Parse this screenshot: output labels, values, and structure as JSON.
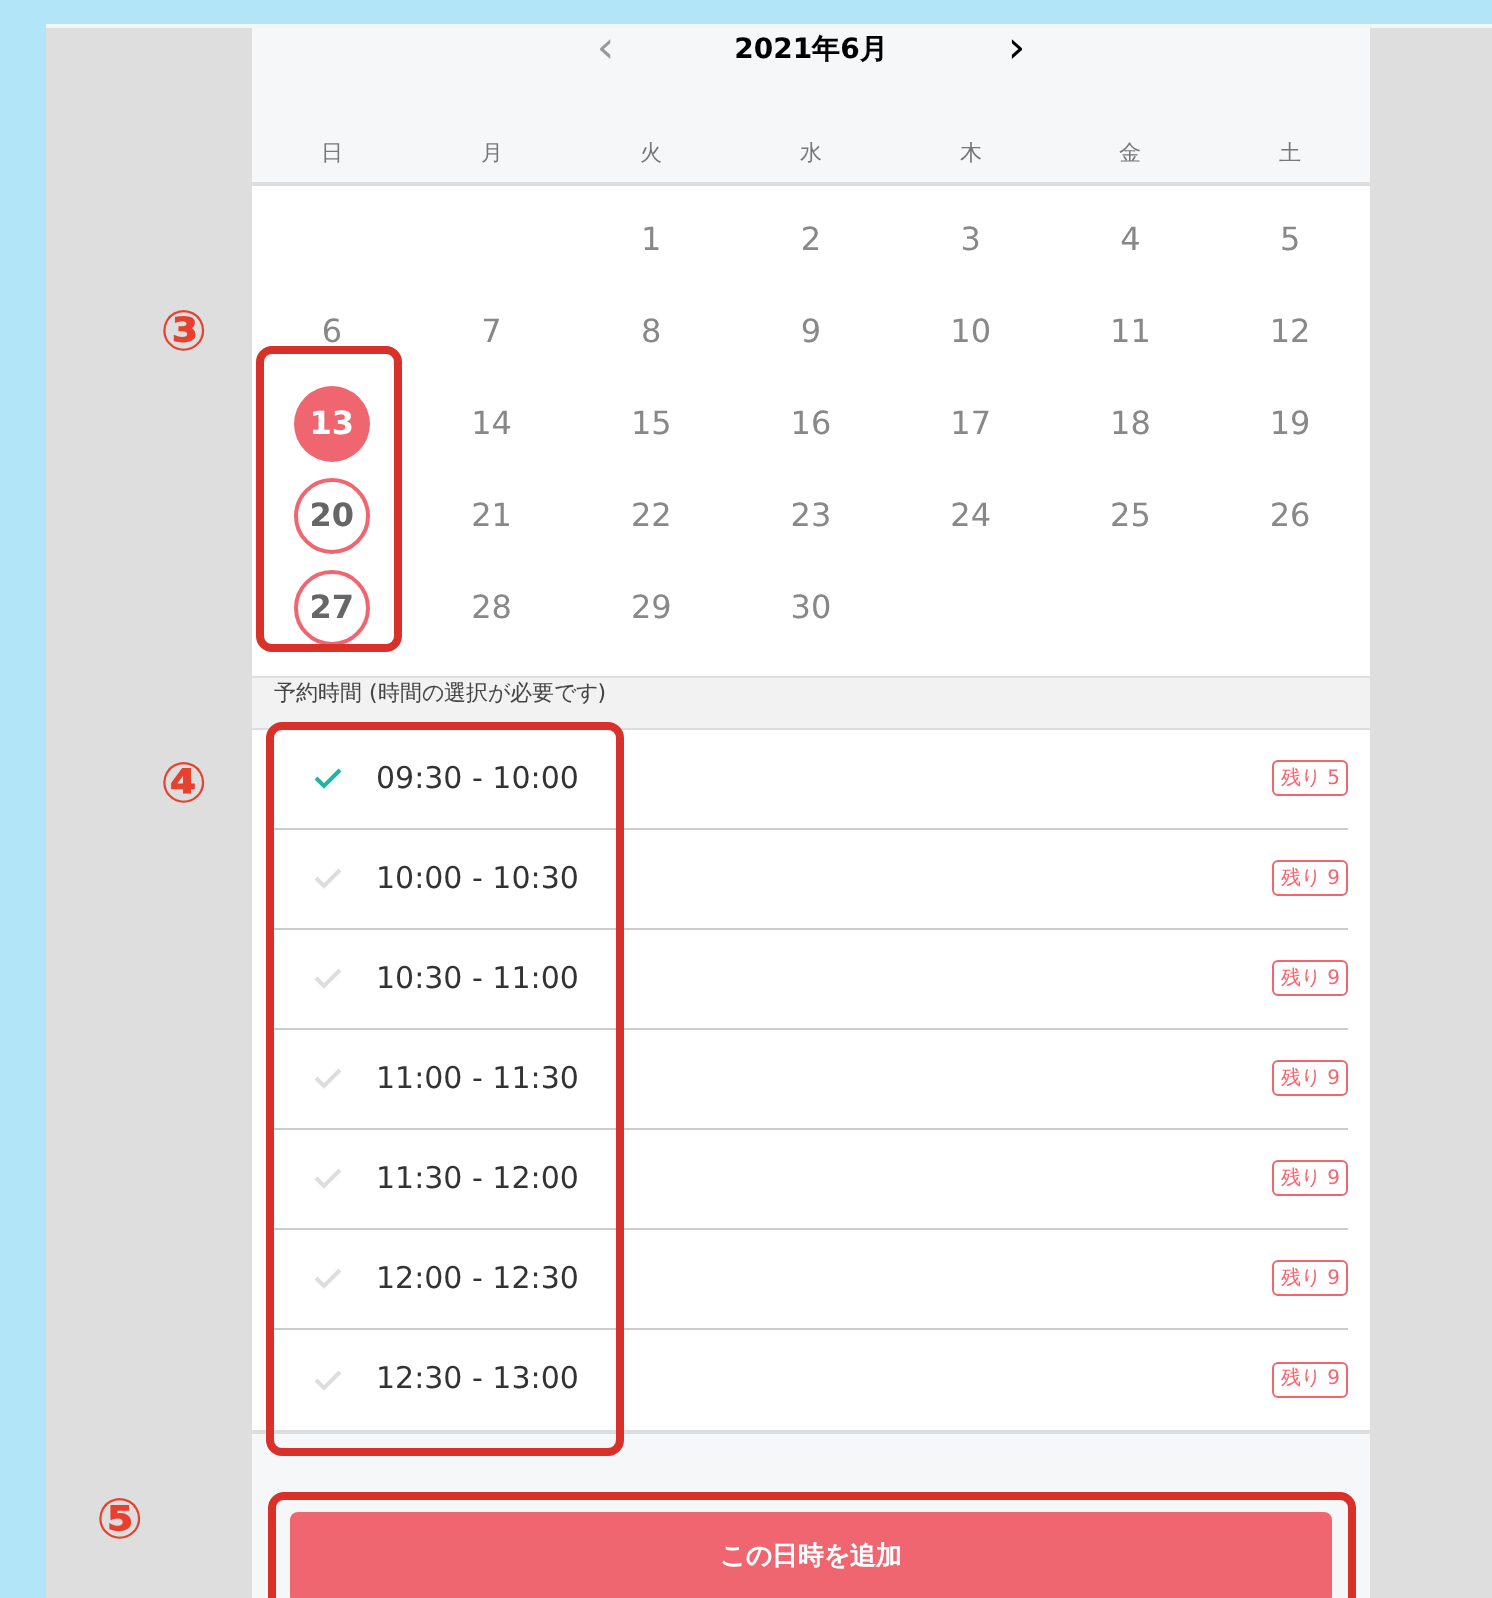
{
  "calendar": {
    "prev": "‹",
    "title": "2021年6月",
    "next": "›",
    "weekdays": [
      "日",
      "月",
      "火",
      "水",
      "木",
      "金",
      "土"
    ],
    "weeks": [
      [
        {
          "kind": "blank"
        },
        {
          "kind": "blank"
        },
        {
          "kind": "day",
          "label": "1",
          "selected": false,
          "available": false
        },
        {
          "kind": "day",
          "label": "2",
          "selected": false,
          "available": false
        },
        {
          "kind": "day",
          "label": "3",
          "selected": false,
          "available": false
        },
        {
          "kind": "day",
          "label": "4",
          "selected": false,
          "available": false
        },
        {
          "kind": "day",
          "label": "5",
          "selected": false,
          "available": false
        }
      ],
      [
        {
          "kind": "day",
          "label": "6",
          "selected": false,
          "available": false
        },
        {
          "kind": "day",
          "label": "7",
          "selected": false,
          "available": false
        },
        {
          "kind": "day",
          "label": "8",
          "selected": false,
          "available": false
        },
        {
          "kind": "day",
          "label": "9",
          "selected": false,
          "available": false
        },
        {
          "kind": "day",
          "label": "10",
          "selected": false,
          "available": false
        },
        {
          "kind": "day",
          "label": "11",
          "selected": false,
          "available": false
        },
        {
          "kind": "day",
          "label": "12",
          "selected": false,
          "available": false
        }
      ],
      [
        {
          "kind": "day",
          "label": "13",
          "selected": true,
          "available": true
        },
        {
          "kind": "day",
          "label": "14",
          "selected": false,
          "available": false
        },
        {
          "kind": "day",
          "label": "15",
          "selected": false,
          "available": false
        },
        {
          "kind": "day",
          "label": "16",
          "selected": false,
          "available": false
        },
        {
          "kind": "day",
          "label": "17",
          "selected": false,
          "available": false
        },
        {
          "kind": "day",
          "label": "18",
          "selected": false,
          "available": false
        },
        {
          "kind": "day",
          "label": "19",
          "selected": false,
          "available": false
        }
      ],
      [
        {
          "kind": "day",
          "label": "20",
          "selected": false,
          "available": true
        },
        {
          "kind": "day",
          "label": "21",
          "selected": false,
          "available": false
        },
        {
          "kind": "day",
          "label": "22",
          "selected": false,
          "available": false
        },
        {
          "kind": "day",
          "label": "23",
          "selected": false,
          "available": false
        },
        {
          "kind": "day",
          "label": "24",
          "selected": false,
          "available": false
        },
        {
          "kind": "day",
          "label": "25",
          "selected": false,
          "available": false
        },
        {
          "kind": "day",
          "label": "26",
          "selected": false,
          "available": false
        }
      ],
      [
        {
          "kind": "day",
          "label": "27",
          "selected": false,
          "available": true
        },
        {
          "kind": "day",
          "label": "28",
          "selected": false,
          "available": false
        },
        {
          "kind": "day",
          "label": "29",
          "selected": false,
          "available": false
        },
        {
          "kind": "day",
          "label": "30",
          "selected": false,
          "available": false
        },
        {
          "kind": "blank"
        },
        {
          "kind": "blank"
        },
        {
          "kind": "blank"
        }
      ]
    ]
  },
  "time_section": {
    "label": "予約時間 (時間の選択が必要です)",
    "slots": [
      {
        "time": "09:30 - 10:00",
        "remaining": "残り 5",
        "selected": true
      },
      {
        "time": "10:00 - 10:30",
        "remaining": "残り 9",
        "selected": false
      },
      {
        "time": "10:30 - 11:00",
        "remaining": "残り 9",
        "selected": false
      },
      {
        "time": "11:00 - 11:30",
        "remaining": "残り 9",
        "selected": false
      },
      {
        "time": "11:30 - 12:00",
        "remaining": "残り 9",
        "selected": false
      },
      {
        "time": "12:00 - 12:30",
        "remaining": "残り 9",
        "selected": false
      },
      {
        "time": "12:30 - 13:00",
        "remaining": "残り 9",
        "selected": false
      }
    ]
  },
  "add_button": "この日時を追加",
  "annotations": [
    "③",
    "④",
    "⑤"
  ]
}
